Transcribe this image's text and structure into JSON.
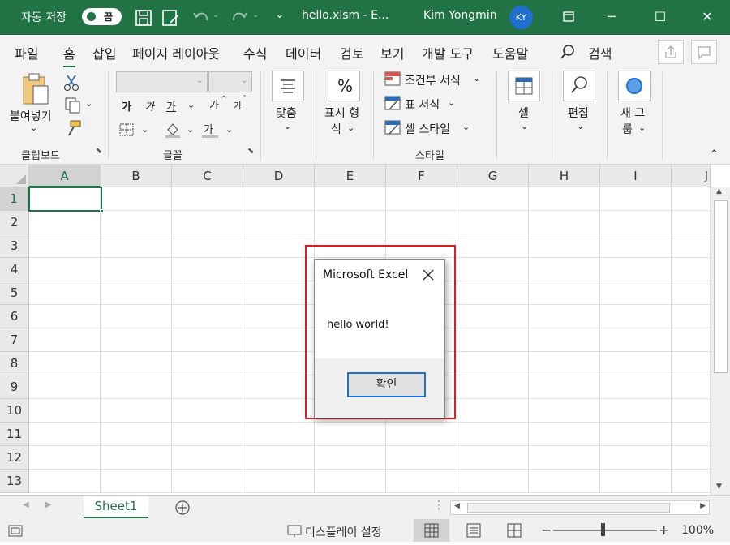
{
  "titlebar": {
    "autosave_label": "자동 저장",
    "autosave_state": "끔",
    "filename": "hello.xlsm  -  E...",
    "user": "Kim Yongmin",
    "avatar_initials": "KY",
    "bg_color": "#217346"
  },
  "menu": {
    "items": [
      "파일",
      "홈",
      "삽입",
      "페이지 레이아웃",
      "수식",
      "데이터",
      "검토",
      "보기",
      "개발 도구",
      "도움말"
    ],
    "active": "홈",
    "search_label": "검색"
  },
  "ribbon": {
    "clipboard": {
      "paste": "붙여넣기",
      "group": "클립보드"
    },
    "font": {
      "bold": "가",
      "italic": "가",
      "underline": "가",
      "grow": "가",
      "shrink": "가",
      "color": "가",
      "group": "글꼴"
    },
    "align": {
      "label": "맞춤"
    },
    "number": {
      "label1": "표시 형",
      "label2": "식",
      "symbol": "%"
    },
    "styles": {
      "conditional": "조건부 서식",
      "table": "표 서식",
      "cell_style": "셀 스타일",
      "group": "스타일"
    },
    "cells": {
      "label": "셀"
    },
    "edit": {
      "label": "편집"
    },
    "new_group": {
      "label1": "새 그",
      "label2": "룹"
    }
  },
  "sheet": {
    "columns": [
      "A",
      "B",
      "C",
      "D",
      "E",
      "F",
      "G",
      "H",
      "I",
      "J"
    ],
    "rows": [
      "1",
      "2",
      "3",
      "4",
      "5",
      "6",
      "7",
      "8",
      "9",
      "10",
      "11",
      "12",
      "13"
    ],
    "selected_cell": "A1"
  },
  "tabs": {
    "sheet_name": "Sheet1"
  },
  "status": {
    "display_settings": "디스플레이 설정",
    "zoom": "100%"
  },
  "dialog": {
    "title": "Microsoft Excel",
    "message": "hello world!",
    "ok_label": "확인"
  }
}
